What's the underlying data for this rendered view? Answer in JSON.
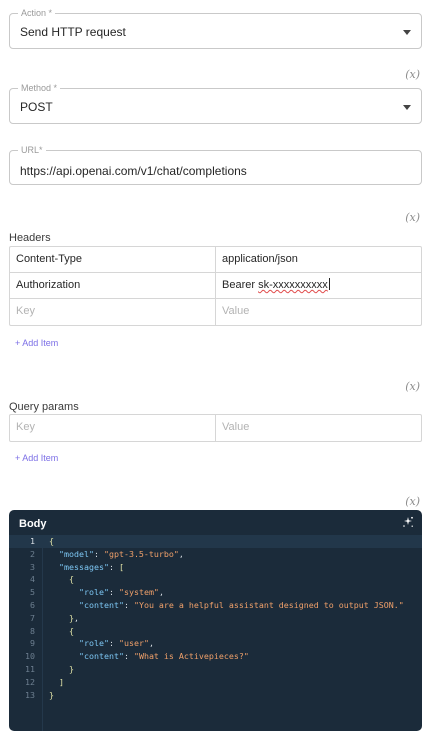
{
  "action": {
    "label": "Action *",
    "value": "Send HTTP request"
  },
  "method": {
    "label": "Method *",
    "value": "POST"
  },
  "url": {
    "label": "URL*",
    "value": "https://api.openai.com/v1/chat/completions"
  },
  "fx_label": "(x)",
  "headers": {
    "label": "Headers",
    "rows": [
      {
        "key": "Content-Type",
        "value": "application/json"
      },
      {
        "key": "Authorization",
        "value_prefix": "Bearer ",
        "value_token": "sk-xxxxxxxxxx"
      }
    ],
    "key_placeholder": "Key",
    "value_placeholder": "Value",
    "add_item": "+ Add Item"
  },
  "query_params": {
    "label": "Query params",
    "key_placeholder": "Key",
    "value_placeholder": "Value",
    "add_item": "+ Add Item"
  },
  "body": {
    "title": "Body",
    "icon": "magic-wand-icon",
    "active_line": 1,
    "line_numbers": [
      "1",
      "2",
      "3",
      "4",
      "5",
      "6",
      "7",
      "8",
      "9",
      "10",
      "11",
      "12",
      "13"
    ]
  }
}
